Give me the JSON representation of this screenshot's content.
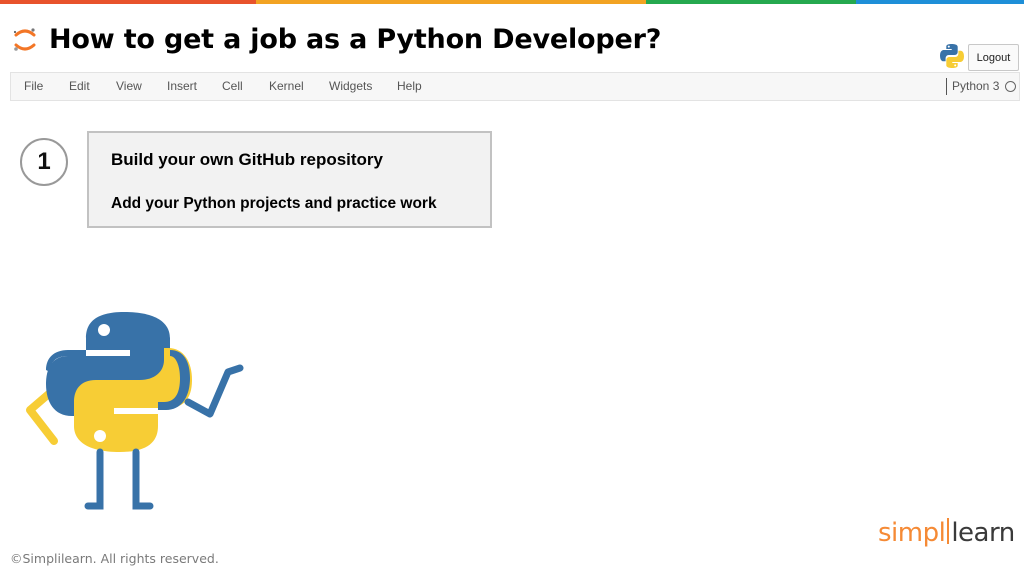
{
  "colors": {
    "stripe": [
      "#e8532c",
      "#f2a322",
      "#25a94f",
      "#1e8fd8"
    ],
    "jupyter_orange": "#f37626",
    "python_blue": "#3872a8",
    "python_yellow": "#f7cd35",
    "brand_orange": "#f58a35"
  },
  "header": {
    "title": "How to get a job as a Python Developer?",
    "logo_icon": "jupyter-logo-icon",
    "kernel_icon": "python-logo-icon",
    "logout_label": "Logout"
  },
  "menubar": {
    "items": [
      "File",
      "Edit",
      "View",
      "Insert",
      "Cell",
      "Kernel",
      "Widgets",
      "Help"
    ],
    "kernel_name": "Python 3",
    "kernel_status_icon": "kernel-idle-circle-icon"
  },
  "step": {
    "number": "1",
    "heading": "Build your own GitHub repository",
    "subtext": "Add your Python projects and practice work"
  },
  "mascot_icon": "python-mascot-icon",
  "footer": {
    "copyright": "©Simplilearn. All rights reserved.",
    "brand_part1": "simpl",
    "brand_part2": "learn"
  }
}
